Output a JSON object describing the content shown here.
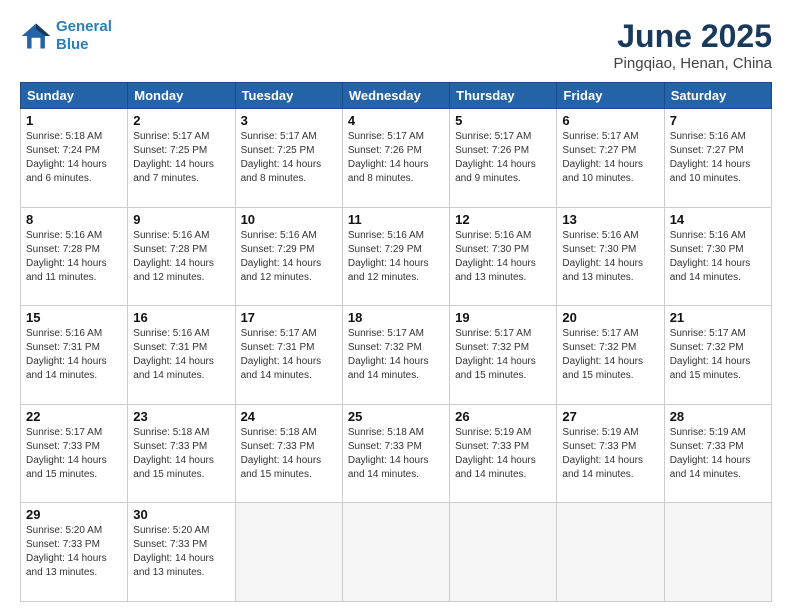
{
  "logo": {
    "line1": "General",
    "line2": "Blue"
  },
  "title": "June 2025",
  "subtitle": "Pingqiao, Henan, China",
  "headers": [
    "Sunday",
    "Monday",
    "Tuesday",
    "Wednesday",
    "Thursday",
    "Friday",
    "Saturday"
  ],
  "weeks": [
    [
      {
        "day": "1",
        "rise": "5:18 AM",
        "set": "7:24 PM",
        "daylight": "14 hours and 6 minutes."
      },
      {
        "day": "2",
        "rise": "5:17 AM",
        "set": "7:25 PM",
        "daylight": "14 hours and 7 minutes."
      },
      {
        "day": "3",
        "rise": "5:17 AM",
        "set": "7:25 PM",
        "daylight": "14 hours and 8 minutes."
      },
      {
        "day": "4",
        "rise": "5:17 AM",
        "set": "7:26 PM",
        "daylight": "14 hours and 8 minutes."
      },
      {
        "day": "5",
        "rise": "5:17 AM",
        "set": "7:26 PM",
        "daylight": "14 hours and 9 minutes."
      },
      {
        "day": "6",
        "rise": "5:17 AM",
        "set": "7:27 PM",
        "daylight": "14 hours and 10 minutes."
      },
      {
        "day": "7",
        "rise": "5:16 AM",
        "set": "7:27 PM",
        "daylight": "14 hours and 10 minutes."
      }
    ],
    [
      {
        "day": "8",
        "rise": "5:16 AM",
        "set": "7:28 PM",
        "daylight": "14 hours and 11 minutes."
      },
      {
        "day": "9",
        "rise": "5:16 AM",
        "set": "7:28 PM",
        "daylight": "14 hours and 12 minutes."
      },
      {
        "day": "10",
        "rise": "5:16 AM",
        "set": "7:29 PM",
        "daylight": "14 hours and 12 minutes."
      },
      {
        "day": "11",
        "rise": "5:16 AM",
        "set": "7:29 PM",
        "daylight": "14 hours and 12 minutes."
      },
      {
        "day": "12",
        "rise": "5:16 AM",
        "set": "7:30 PM",
        "daylight": "14 hours and 13 minutes."
      },
      {
        "day": "13",
        "rise": "5:16 AM",
        "set": "7:30 PM",
        "daylight": "14 hours and 13 minutes."
      },
      {
        "day": "14",
        "rise": "5:16 AM",
        "set": "7:30 PM",
        "daylight": "14 hours and 14 minutes."
      }
    ],
    [
      {
        "day": "15",
        "rise": "5:16 AM",
        "set": "7:31 PM",
        "daylight": "14 hours and 14 minutes."
      },
      {
        "day": "16",
        "rise": "5:16 AM",
        "set": "7:31 PM",
        "daylight": "14 hours and 14 minutes."
      },
      {
        "day": "17",
        "rise": "5:17 AM",
        "set": "7:31 PM",
        "daylight": "14 hours and 14 minutes."
      },
      {
        "day": "18",
        "rise": "5:17 AM",
        "set": "7:32 PM",
        "daylight": "14 hours and 14 minutes."
      },
      {
        "day": "19",
        "rise": "5:17 AM",
        "set": "7:32 PM",
        "daylight": "14 hours and 15 minutes."
      },
      {
        "day": "20",
        "rise": "5:17 AM",
        "set": "7:32 PM",
        "daylight": "14 hours and 15 minutes."
      },
      {
        "day": "21",
        "rise": "5:17 AM",
        "set": "7:32 PM",
        "daylight": "14 hours and 15 minutes."
      }
    ],
    [
      {
        "day": "22",
        "rise": "5:17 AM",
        "set": "7:33 PM",
        "daylight": "14 hours and 15 minutes."
      },
      {
        "day": "23",
        "rise": "5:18 AM",
        "set": "7:33 PM",
        "daylight": "14 hours and 15 minutes."
      },
      {
        "day": "24",
        "rise": "5:18 AM",
        "set": "7:33 PM",
        "daylight": "14 hours and 15 minutes."
      },
      {
        "day": "25",
        "rise": "5:18 AM",
        "set": "7:33 PM",
        "daylight": "14 hours and 14 minutes."
      },
      {
        "day": "26",
        "rise": "5:19 AM",
        "set": "7:33 PM",
        "daylight": "14 hours and 14 minutes."
      },
      {
        "day": "27",
        "rise": "5:19 AM",
        "set": "7:33 PM",
        "daylight": "14 hours and 14 minutes."
      },
      {
        "day": "28",
        "rise": "5:19 AM",
        "set": "7:33 PM",
        "daylight": "14 hours and 14 minutes."
      }
    ],
    [
      {
        "day": "29",
        "rise": "5:20 AM",
        "set": "7:33 PM",
        "daylight": "14 hours and 13 minutes."
      },
      {
        "day": "30",
        "rise": "5:20 AM",
        "set": "7:33 PM",
        "daylight": "14 hours and 13 minutes."
      },
      null,
      null,
      null,
      null,
      null
    ]
  ],
  "daylight_label": "Daylight:",
  "sunrise_label": "Sunrise:",
  "sunset_label": "Sunset:"
}
